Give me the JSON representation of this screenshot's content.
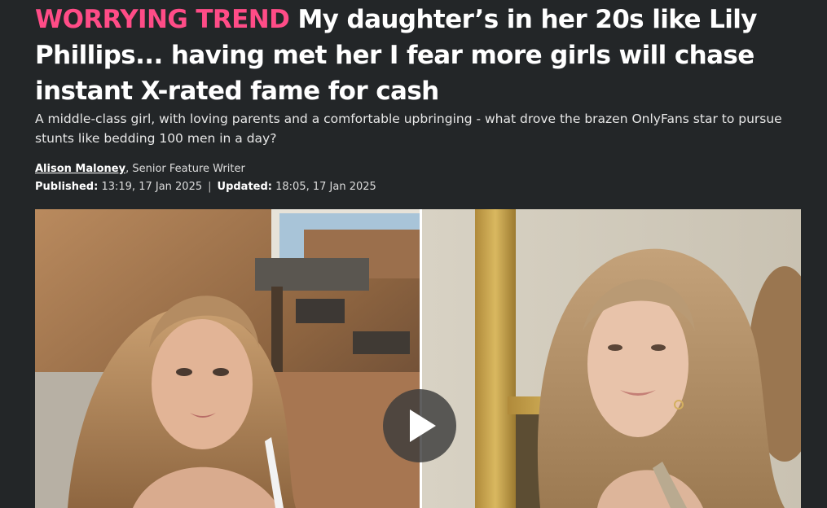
{
  "article": {
    "kicker": "WORRYING TREND",
    "headline": "My daughter’s in her 20s like Lily Phillips... having met her I fear more girls will chase instant X-rated fame for cash",
    "standfirst": "A middle-class girl, with loving parents and a comfortable upbringing - what drove the brazen OnlyFans star to pursue stunts like bedding 100 men in a day?",
    "author": {
      "name": "Alison Maloney",
      "role": ", Senior Feature Writer"
    },
    "published_label": "Published:",
    "published_value": " 13:19, 17 Jan 2025",
    "separator": "|",
    "updated_label": "Updated:",
    "updated_value": " 18:05, 17 Jan 2025"
  },
  "media": {
    "type": "video",
    "play_icon": "play-icon"
  },
  "colors": {
    "background": "#232628",
    "kicker": "#ff4c87",
    "text": "#ffffff"
  }
}
